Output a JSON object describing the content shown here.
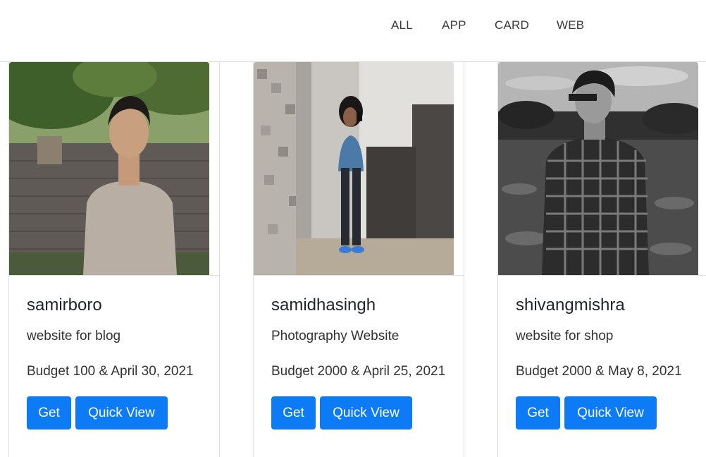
{
  "nav": {
    "items": [
      "ALL",
      "APP",
      "CARD",
      "WEB"
    ]
  },
  "colors": {
    "primary_button": "#0d7bf5",
    "nav_text": "#3a3a3a"
  },
  "cards": [
    {
      "name": "samirboro",
      "description": "website for blog",
      "budget": "Budget 100 & April 30, 2021",
      "get_label": "Get",
      "quick_view_label": "Quick View",
      "photo": "man-outdoors-photo"
    },
    {
      "name": "samidhasingh",
      "description": "Photography Website",
      "budget": "Budget 2000 & April 25, 2021",
      "get_label": "Get",
      "quick_view_label": "Quick View",
      "photo": "woman-mirror-selfie-photo"
    },
    {
      "name": "shivangmishra",
      "description": "website for shop",
      "budget": "Budget 2000 & May 8, 2021",
      "get_label": "Get",
      "quick_view_label": "Quick View",
      "photo": "man-bw-field-photo"
    }
  ]
}
